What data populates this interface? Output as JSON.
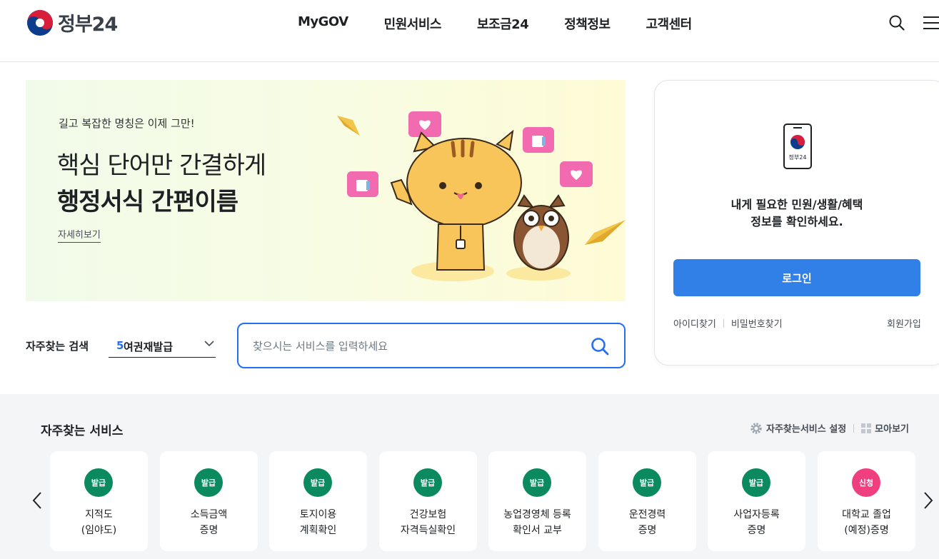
{
  "header": {
    "logo_text": "정부24",
    "nav": [
      "MyGOV",
      "민원서비스",
      "보조금24",
      "정책정보",
      "고객센터"
    ]
  },
  "banner": {
    "subtitle": "길고 복잡한 명칭은 이제 그만!",
    "line1": "핵심 단어만 간결하게",
    "line2": "행정서식 간편이름",
    "more": "자세히보기"
  },
  "frequent_search": {
    "label": "자주찾는 검색",
    "rank": "5",
    "term": "여권재발급"
  },
  "search": {
    "placeholder": "찾으시는 서비스를 입력하세요"
  },
  "login": {
    "device_logo_text": "정부24",
    "message_line1": "내게 필요한 민원/생활/혜택",
    "message_line2": "정보를 확인하세요.",
    "button": "로그인",
    "find_id": "아이디찾기",
    "find_pw": "비밀번호찾기",
    "join": "회원가입"
  },
  "services": {
    "title": "자주찾는 서비스",
    "settings": "자주찾는서비스 설정",
    "view_all": "모아보기",
    "items": [
      {
        "badge": "발급",
        "line1": "지적도",
        "line2": "(임야도)"
      },
      {
        "badge": "발급",
        "line1": "소득금액",
        "line2": "증명"
      },
      {
        "badge": "발급",
        "line1": "토지이용",
        "line2": "계획확인"
      },
      {
        "badge": "발급",
        "line1": "건강보험",
        "line2": "자격득실확인"
      },
      {
        "badge": "발급",
        "line1": "농업경영체 등록",
        "line2": "확인서 교부"
      },
      {
        "badge": "발급",
        "line1": "운전경력",
        "line2": "증명"
      },
      {
        "badge": "발급",
        "line1": "사업자등록",
        "line2": "증명"
      },
      {
        "badge": "신청",
        "line1": "대학교 졸업",
        "line2": "(예정)증명"
      }
    ]
  },
  "colors": {
    "accent": "#256ef4",
    "login_button": "#3080e8",
    "badge_issue": "#0b8a5f",
    "badge_apply": "#ef3f7f"
  }
}
